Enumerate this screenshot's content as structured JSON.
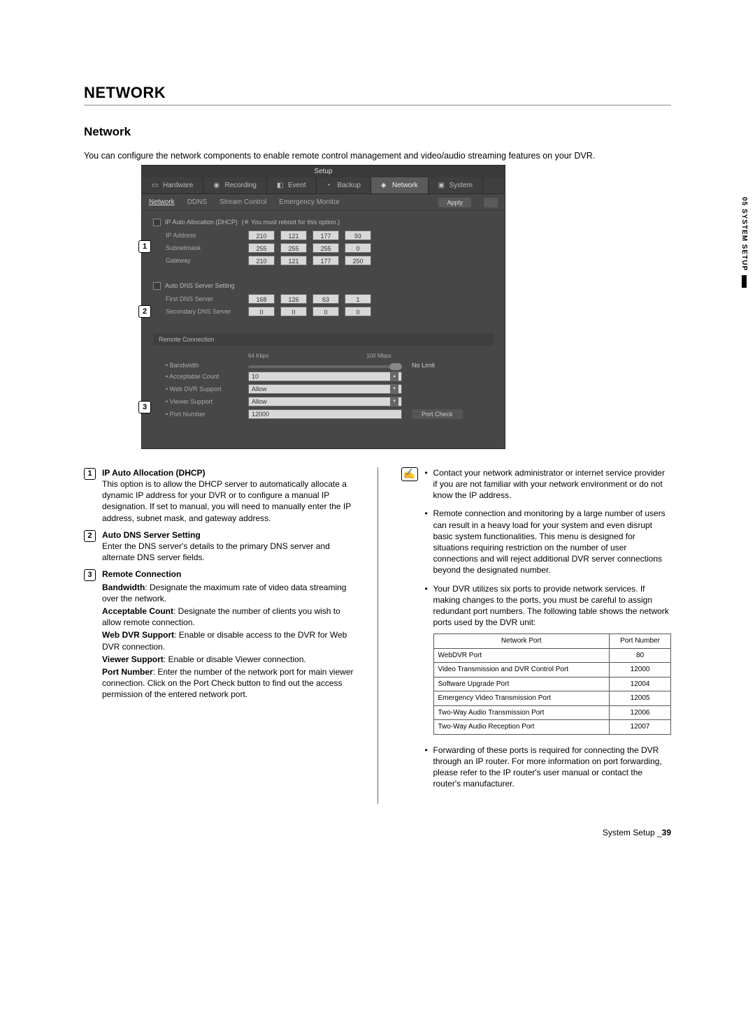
{
  "sideTab": "05 SYSTEM SETUP",
  "pageTitle": "NETWORK",
  "subheading": "Network",
  "introText": "You can configure the network components to enable remote control management and video/audio streaming features on your DVR.",
  "screenshot": {
    "windowTitle": "Setup",
    "tabs": {
      "hardware": "Hardware",
      "recording": "Recording",
      "event": "Event",
      "backup": "Backup",
      "network": "Network",
      "system": "System"
    },
    "subtabs": {
      "network": "Network",
      "ddns": "DDNS",
      "streamControl": "Stream Control",
      "emergencyMonitor": "Emergency Monitor"
    },
    "applyLabel": "Apply",
    "dhcp": {
      "label": "IP Auto Allocation (DHCP)",
      "note": "(※ You must reboot for this option.)",
      "ipAddressLabel": "IP Address",
      "ipAddress": [
        "210",
        "121",
        "177",
        "93"
      ],
      "subnetLabel": "Subnetmask",
      "subnet": [
        "255",
        "255",
        "255",
        "0"
      ],
      "gatewayLabel": "Gateway",
      "gateway": [
        "210",
        "121",
        "177",
        "250"
      ]
    },
    "dns": {
      "label": "Auto DNS Server Setting",
      "firstLabel": "First DNS Server",
      "first": [
        "168",
        "126",
        "63",
        "1"
      ],
      "secondLabel": "Secondary DNS Server",
      "second": [
        "0",
        "0",
        "0",
        "0"
      ]
    },
    "remote": {
      "sectionLabel": "Remote Connection",
      "bwLeft": "64 Kbps",
      "bwRight": "100 Mbps",
      "bandwidthLabel": "Bandwidth",
      "bandwidthValue": "No Limit",
      "countLabel": "Acceptable Count",
      "countValue": "10",
      "webDvrLabel": "Web DVR Support",
      "webDvrValue": "Allow",
      "viewerLabel": "Viewer Support",
      "viewerValue": "Allow",
      "portLabel": "Port Number",
      "portValue": "12000",
      "portCheckLabel": "Port Check"
    }
  },
  "defs": {
    "d1": {
      "term": "IP Auto Allocation (DHCP)",
      "body": "This option is to allow the DHCP server to automatically allocate a dynamic IP address for your DVR or to configure a manual IP designation. If set to manual, you will need to manually enter the IP address, subnet mask, and gateway address."
    },
    "d2": {
      "term": "Auto DNS Server Setting",
      "body": "Enter the DNS server's details to the primary DNS server and alternate DNS server fields."
    },
    "d3": {
      "term": "Remote Connection",
      "bandwidth": {
        "label": "Bandwidth",
        "text": ": Designate the maximum rate of video data streaming over the network."
      },
      "count": {
        "label": "Acceptable Count",
        "text": ": Designate the number of clients you wish to allow remote connection."
      },
      "webdvr": {
        "label": "Web DVR Support",
        "text": ": Enable or disable access to the DVR for Web DVR connection."
      },
      "viewer": {
        "label": "Viewer Support",
        "text": ": Enable or disable Viewer connection."
      },
      "port": {
        "label": "Port Number",
        "text": ": Enter the number of the network port for main viewer connection. Click on the Port Check button to find out the access permission of the entered network port."
      }
    }
  },
  "notes": {
    "n1": "Contact your network administrator or internet service provider if you are not familiar with your network environment or do not know the IP address.",
    "n2": "Remote connection and monitoring by a large number of users can result in a heavy load for your system and even disrupt basic system functionalities. This menu is designed for situations requiring restriction on the number of user connections and will reject additional DVR server connections beyond the designated number.",
    "n3": "Your DVR utilizes six ports to provide network services. If making changes to the ports, you must be careful to assign redundant port numbers. The following table shows the network ports used by the DVR unit:",
    "n4": "Forwarding of these ports is required for connecting the DVR through an IP router. For more information on port forwarding, please refer to the IP router's user manual or contact the router's manufacturer."
  },
  "portsTable": {
    "h1": "Network Port",
    "h2": "Port Number",
    "rows": [
      {
        "name": "WebDVR Port",
        "port": "80"
      },
      {
        "name": "Video Transmission and DVR Control Port",
        "port": "12000"
      },
      {
        "name": "Software Upgrade Port",
        "port": "12004"
      },
      {
        "name": "Emergency Video Transmission Port",
        "port": "12005"
      },
      {
        "name": "Two-Way Audio Transmission Port",
        "port": "12006"
      },
      {
        "name": "Two-Way Audio Reception Port",
        "port": "12007"
      }
    ]
  },
  "footer": {
    "section": "System Setup _",
    "page": "39"
  }
}
